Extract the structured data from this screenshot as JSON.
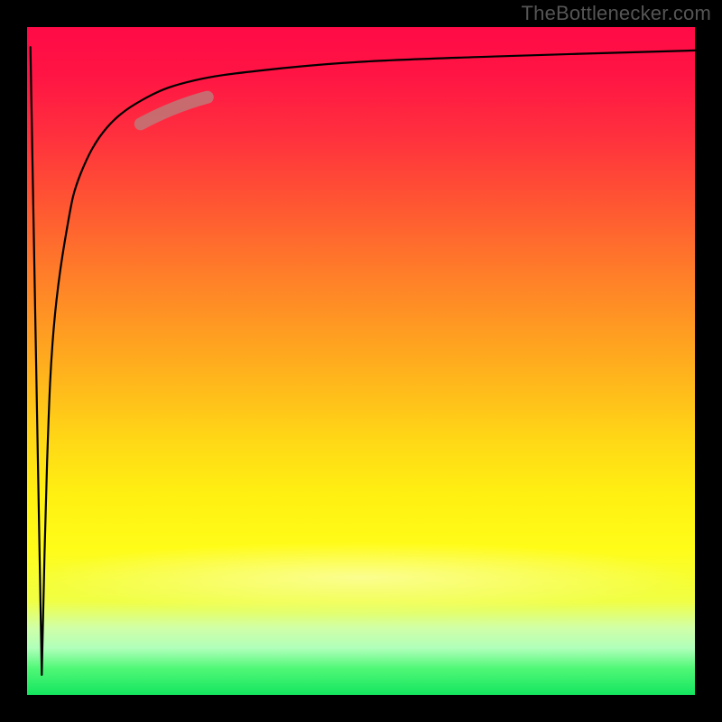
{
  "watermark": "TheBottlenecker.com",
  "chart_data": {
    "type": "line",
    "title": "",
    "xlabel": "",
    "ylabel": "",
    "xlim": [
      0,
      100
    ],
    "ylim": [
      0,
      100
    ],
    "series": [
      {
        "name": "falling-segment",
        "x": [
          0.5,
          2.2
        ],
        "y": [
          97.0,
          3.0
        ]
      },
      {
        "name": "rising-curve",
        "x": [
          2.2,
          3,
          4,
          6,
          8,
          12,
          18,
          25,
          35,
          50,
          70,
          100
        ],
        "y": [
          3.0,
          35.0,
          55.0,
          70.0,
          78.0,
          85.0,
          89.5,
          92.0,
          93.5,
          94.8,
          95.6,
          96.5
        ]
      }
    ],
    "highlight_segment": {
      "x": [
        17,
        27
      ],
      "y": [
        85.5,
        89.5
      ]
    },
    "background_gradient": {
      "top": "#ff0a46",
      "mid": "#ffe016",
      "bottom": "#14e55e"
    }
  }
}
